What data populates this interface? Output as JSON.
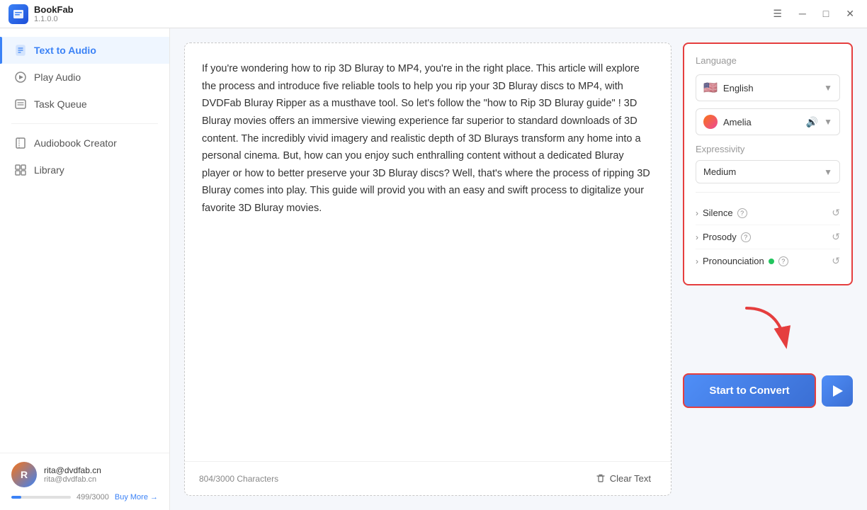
{
  "app": {
    "name": "BookFab",
    "version": "1.1.0.0",
    "icon_letter": "📚"
  },
  "titlebar": {
    "menu_icon": "☰",
    "minimize_icon": "─",
    "maximize_icon": "□",
    "close_icon": "✕"
  },
  "sidebar": {
    "nav_items": [
      {
        "id": "text-to-audio",
        "label": "Text to Audio",
        "icon": "doc",
        "active": true
      },
      {
        "id": "play-audio",
        "label": "Play Audio",
        "icon": "circle-play",
        "active": false
      },
      {
        "id": "task-queue",
        "label": "Task Queue",
        "icon": "list",
        "active": false
      }
    ],
    "secondary_items": [
      {
        "id": "audiobook-creator",
        "label": "Audiobook Creator",
        "icon": "book"
      },
      {
        "id": "library",
        "label": "Library",
        "icon": "grid"
      }
    ],
    "user": {
      "email": "rita@dvdfab.cn",
      "email2": "rita@dvdfab.cn",
      "usage": "499/3000",
      "usage_pct": 16.6,
      "buy_more": "Buy More →"
    }
  },
  "editor": {
    "content": "If you're wondering how to rip 3D Bluray to MP4, you're in the right place. This article will explore the process and introduce five reliable tools to help you rip your 3D Bluray discs to MP4, with DVDFab Bluray Ripper as a musthave tool. So let's follow the \"how to Rip 3D Bluray guide\" !\n3D Bluray movies offers an immersive viewing experience far superior to standard downloads of 3D content. The incredibly vivid imagery and realistic depth of 3D Blurays transform any home into a personal cinema. But, how can you enjoy such enthralling content without a dedicated Bluray player or how to better preserve your 3D Bluray discs? Well, that's where the process of ripping 3D Bluray comes into play. This guide will provid you with an easy and swift process to digitalize your favorite 3D Bluray movies.",
    "char_count": "804/3000 Characters",
    "clear_text": "Clear Text"
  },
  "settings": {
    "panel_label": "Language",
    "language": {
      "selected": "English",
      "flag": "🇺🇸"
    },
    "voice": {
      "selected": "Amelia"
    },
    "expressivity_label": "Expressivity",
    "expressivity_selected": "Medium",
    "sections": [
      {
        "id": "silence",
        "label": "Silence",
        "has_help": true
      },
      {
        "id": "prosody",
        "label": "Prosody",
        "has_help": true
      },
      {
        "id": "pronounciation",
        "label": "Pronounciation",
        "has_help": true,
        "has_badge": true
      }
    ]
  },
  "convert": {
    "button_label": "Start to Convert",
    "play_icon": "▶"
  }
}
